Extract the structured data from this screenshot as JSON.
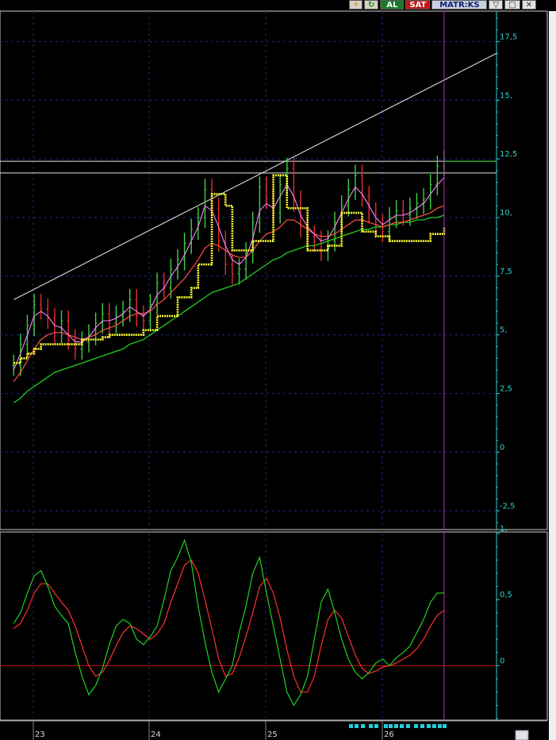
{
  "toolbar": {
    "buy_label": "AL",
    "sell_label": "SAT",
    "brand": "MATR:KS"
  },
  "colors": {
    "background": "#000000",
    "price_bar": "#e03030",
    "price_bar_up": "#40d040",
    "sma_short": "#ff80ff",
    "sma_mid": "#ff5040",
    "sma_long": "#20d020",
    "stop_line": "#ffff30",
    "oscillator_fast": "#20d020",
    "oscillator_slow": "#ff3030",
    "axis": "#2fd0d0"
  },
  "chart_data": [
    {
      "type": "line",
      "panel": "price",
      "x_ticks": [
        "23",
        "24",
        "25",
        "26"
      ],
      "y_ticks": [
        "17,5",
        "15,",
        "12,5",
        "10,",
        "7,5",
        "5,",
        "2,5",
        "0",
        "-2,5"
      ],
      "ylim": [
        -3.2,
        18.8
      ],
      "grid": true,
      "x": [
        0,
        3,
        6,
        9,
        12,
        15,
        18,
        21,
        24,
        27,
        30,
        33,
        36,
        39,
        42,
        45,
        48,
        51,
        54,
        57,
        60,
        63,
        66,
        69,
        72,
        75,
        78,
        81,
        84,
        87,
        90,
        93,
        96,
        99,
        102,
        105,
        108,
        111,
        114,
        117,
        120,
        123,
        126,
        129,
        132,
        135,
        138,
        141,
        144,
        147,
        150,
        153,
        156,
        159,
        162,
        165,
        168,
        171,
        174,
        177,
        180,
        183,
        186,
        189
      ],
      "series": [
        {
          "name": "",
          "role": "close",
          "values": [
            3.7,
            4.6,
            5.4,
            6.3,
            6.1,
            5.7,
            5.1,
            5.6,
            4.8,
            4.4,
            4.7,
            5.0,
            5.5,
            5.9,
            5.5,
            5.8,
            6.0,
            6.5,
            5.8,
            5.6,
            6.3,
            7.2,
            7.0,
            7.8,
            8.2,
            8.9,
            9.5,
            10.0,
            11.2,
            10.4,
            9.0,
            8.0,
            7.6,
            7.8,
            8.5,
            9.8,
            11.3,
            10.8,
            10.2,
            11.4,
            12.1,
            10.7,
            9.6,
            9.2,
            9.0,
            8.6,
            9.0,
            9.8,
            10.5,
            11.2,
            11.8,
            10.9,
            10.2,
            9.7,
            9.4,
            10.0,
            10.3,
            10.1,
            10.4,
            10.6,
            10.8,
            11.4,
            12.2,
            12.4
          ]
        },
        {
          "name": "",
          "role": "sma_short",
          "values": [
            3.5,
            4.2,
            5.0,
            5.8,
            6.0,
            5.8,
            5.4,
            5.3,
            5.0,
            4.7,
            4.7,
            4.9,
            5.3,
            5.6,
            5.6,
            5.7,
            5.9,
            6.2,
            6.0,
            5.8,
            6.1,
            6.7,
            7.0,
            7.5,
            7.9,
            8.4,
            9.0,
            9.6,
            10.5,
            10.3,
            9.6,
            8.8,
            8.2,
            8.0,
            8.3,
            9.1,
            10.3,
            10.6,
            10.4,
            10.9,
            11.4,
            10.9,
            10.1,
            9.6,
            9.3,
            9.0,
            9.1,
            9.6,
            10.2,
            10.8,
            11.3,
            11.0,
            10.5,
            10.0,
            9.7,
            9.9,
            10.1,
            10.1,
            10.2,
            10.4,
            10.6,
            11.0,
            11.4,
            11.7
          ]
        },
        {
          "name": "",
          "role": "sma_mid",
          "values": [
            3.0,
            3.4,
            3.9,
            4.4,
            4.8,
            5.0,
            5.1,
            5.1,
            5.0,
            4.9,
            4.8,
            4.9,
            5.0,
            5.2,
            5.3,
            5.4,
            5.6,
            5.8,
            5.9,
            5.9,
            6.0,
            6.3,
            6.5,
            6.8,
            7.1,
            7.4,
            7.8,
            8.2,
            8.7,
            8.9,
            8.8,
            8.6,
            8.4,
            8.3,
            8.3,
            8.6,
            9.0,
            9.3,
            9.4,
            9.6,
            9.9,
            9.9,
            9.7,
            9.5,
            9.3,
            9.2,
            9.2,
            9.3,
            9.5,
            9.7,
            9.9,
            9.9,
            9.8,
            9.7,
            9.6,
            9.7,
            9.8,
            9.8,
            9.9,
            10.0,
            10.1,
            10.2,
            10.4,
            10.5
          ]
        },
        {
          "name": "",
          "role": "sma_long",
          "values": [
            2.1,
            2.3,
            2.6,
            2.8,
            3.0,
            3.2,
            3.4,
            3.5,
            3.6,
            3.7,
            3.8,
            3.9,
            4.0,
            4.1,
            4.2,
            4.3,
            4.4,
            4.6,
            4.7,
            4.8,
            5.0,
            5.2,
            5.4,
            5.6,
            5.8,
            6.0,
            6.2,
            6.4,
            6.6,
            6.8,
            6.9,
            7.0,
            7.1,
            7.2,
            7.4,
            7.6,
            7.8,
            8.0,
            8.2,
            8.3,
            8.5,
            8.6,
            8.7,
            8.8,
            8.8,
            8.9,
            9.0,
            9.1,
            9.2,
            9.3,
            9.4,
            9.5,
            9.5,
            9.6,
            9.6,
            9.7,
            9.7,
            9.8,
            9.8,
            9.9,
            9.9,
            10.0,
            10.0,
            10.1
          ]
        },
        {
          "name": "",
          "role": "stop",
          "values": [
            3.8,
            4.0,
            4.2,
            4.4,
            4.6,
            4.6,
            4.6,
            4.6,
            4.6,
            4.6,
            4.8,
            4.8,
            4.8,
            4.9,
            5.0,
            5.0,
            5.0,
            5.0,
            5.0,
            5.2,
            5.2,
            5.8,
            5.8,
            5.8,
            6.6,
            6.6,
            7.0,
            8.0,
            8.0,
            11.0,
            11.0,
            10.5,
            8.6,
            8.6,
            8.6,
            9.0,
            9.0,
            9.0,
            11.8,
            11.8,
            10.4,
            10.4,
            10.4,
            8.6,
            8.6,
            8.6,
            8.8,
            8.8,
            10.2,
            10.2,
            10.2,
            9.4,
            9.4,
            9.2,
            9.2,
            9.0,
            9.0,
            9.0,
            9.0,
            9.0,
            9.0,
            9.3,
            9.3,
            9.6
          ]
        }
      ],
      "trendlines": [
        {
          "x1": 0,
          "y1": 6.5,
          "x2": 212,
          "y2": 17.0
        },
        {
          "x1": -10,
          "y1": 12.0,
          "x2": 212,
          "y2": 12.0
        }
      ],
      "resistance_band": {
        "low": 11.9,
        "high": 12.4
      },
      "marker_x": 189
    },
    {
      "type": "line",
      "panel": "oscillator",
      "y_ticks": [
        "1,",
        "0,5",
        "0"
      ],
      "ylim": [
        -0.4,
        1.0
      ],
      "grid": true,
      "x": [
        0,
        3,
        6,
        9,
        12,
        15,
        18,
        21,
        24,
        27,
        30,
        33,
        36,
        39,
        42,
        45,
        48,
        51,
        54,
        57,
        60,
        63,
        66,
        69,
        72,
        75,
        78,
        81,
        84,
        87,
        90,
        93,
        96,
        99,
        102,
        105,
        108,
        111,
        114,
        117,
        120,
        123,
        126,
        129,
        132,
        135,
        138,
        141,
        144,
        147,
        150,
        153,
        156,
        159,
        162,
        165,
        168,
        171,
        174,
        177,
        180,
        183,
        186,
        189
      ],
      "series": [
        {
          "name": "",
          "role": "fast",
          "values": [
            0.32,
            0.4,
            0.55,
            0.68,
            0.72,
            0.6,
            0.45,
            0.38,
            0.32,
            0.1,
            -0.08,
            -0.22,
            -0.15,
            -0.02,
            0.16,
            0.3,
            0.35,
            0.32,
            0.2,
            0.16,
            0.22,
            0.3,
            0.5,
            0.72,
            0.82,
            0.95,
            0.78,
            0.45,
            0.18,
            -0.05,
            -0.2,
            -0.1,
            0.0,
            0.25,
            0.45,
            0.7,
            0.82,
            0.55,
            0.3,
            0.05,
            -0.2,
            -0.3,
            -0.22,
            -0.08,
            0.2,
            0.48,
            0.58,
            0.4,
            0.2,
            0.05,
            -0.05,
            -0.1,
            -0.05,
            0.02,
            0.05,
            0.0,
            0.06,
            0.1,
            0.15,
            0.25,
            0.35,
            0.48,
            0.55,
            0.55
          ]
        },
        {
          "name": "",
          "role": "slow",
          "values": [
            0.28,
            0.32,
            0.42,
            0.55,
            0.62,
            0.62,
            0.55,
            0.48,
            0.42,
            0.3,
            0.15,
            0.0,
            -0.08,
            -0.05,
            0.04,
            0.15,
            0.25,
            0.3,
            0.28,
            0.24,
            0.2,
            0.24,
            0.32,
            0.48,
            0.62,
            0.76,
            0.8,
            0.7,
            0.5,
            0.28,
            0.05,
            -0.08,
            -0.06,
            0.06,
            0.22,
            0.4,
            0.6,
            0.66,
            0.55,
            0.36,
            0.12,
            -0.08,
            -0.2,
            -0.2,
            -0.08,
            0.15,
            0.35,
            0.42,
            0.36,
            0.22,
            0.08,
            -0.02,
            -0.06,
            -0.04,
            -0.01,
            0.0,
            0.02,
            0.05,
            0.08,
            0.13,
            0.2,
            0.3,
            0.38,
            0.42
          ]
        }
      ],
      "zero_line": 0,
      "marker_x": 189
    }
  ]
}
